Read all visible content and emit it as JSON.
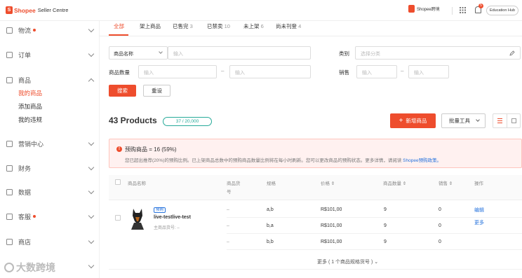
{
  "topbar": {
    "logo_text": "Shopee",
    "logo_sub": "Seller Centre",
    "store_label": "Shopee跨境",
    "notification_count": "5",
    "education_hub": "Education Hub"
  },
  "sidebar": {
    "items": [
      {
        "label": "物流",
        "dot": true
      },
      {
        "label": "订单",
        "dot": false
      },
      {
        "label": "商品",
        "dot": false
      },
      {
        "label": "营销中心",
        "dot": false
      },
      {
        "label": "财务",
        "dot": false
      },
      {
        "label": "数据",
        "dot": false
      },
      {
        "label": "客服",
        "dot": true
      },
      {
        "label": "商店",
        "dot": false
      }
    ],
    "sub_items": [
      "我的商品",
      "添加商品",
      "我的违规"
    ]
  },
  "tabs": [
    {
      "label": "全部",
      "count": ""
    },
    {
      "label": "架上商品",
      "count": ""
    },
    {
      "label": "已售完",
      "count": "3"
    },
    {
      "label": "已禁卖",
      "count": "10"
    },
    {
      "label": "未上架",
      "count": "6"
    },
    {
      "label": "尚未刊登",
      "count": "4"
    }
  ],
  "filters": {
    "name_select": "商品名称",
    "name_placeholder": "输入",
    "category_label": "类别",
    "category_placeholder": "选择分类",
    "qty_label": "商品数量",
    "qty_min_placeholder": "输入",
    "qty_max_placeholder": "输入",
    "sales_label": "销售",
    "sales_min_placeholder": "输入",
    "sales_max_placeholder": "输入",
    "range_sep": "–",
    "search_button": "搜索",
    "reset_button": "重设"
  },
  "products_header": {
    "title": "43 Products",
    "count_badge": "37 / 20,000",
    "add_button": "新增商品",
    "bulk_tools": "批量工具"
  },
  "alert": {
    "title": "预购商品 = 16 (59%)",
    "body": "您已超出推荐(20%)的预购比例。已上架商品总数中的预购商品数量比例将在每小时刷新。您可以更改商品的预购状态。更多详情，请阅读",
    "link": "Shopee预购政策。"
  },
  "table": {
    "headers": {
      "name": "商品名称",
      "sku": "商品货",
      "sku2": "号",
      "variation": "规格",
      "price": "价格",
      "stock": "商品数量",
      "sales": "销售",
      "action": "操作"
    },
    "product": {
      "tag": "预购",
      "name": "live-testlive-test",
      "parent_sku": "主商品货号: –"
    },
    "rows": [
      {
        "sku": "–",
        "variation": "a,b",
        "price": "R$101,00",
        "stock": "9",
        "sales": "0"
      },
      {
        "sku": "–",
        "variation": "b,a",
        "price": "R$101,00",
        "stock": "9",
        "sales": "0"
      },
      {
        "sku": "–",
        "variation": "b,b",
        "price": "R$101,00",
        "stock": "9",
        "sales": "0"
      }
    ],
    "actions": {
      "edit": "编辑",
      "more": "更多"
    },
    "more_variations": "更多 ( 1 个商品规格货号 )"
  },
  "watermark": "大数跨境",
  "colors": {
    "brand": "#ee4d2d",
    "link": "#2673dd",
    "teal": "#26aa99"
  }
}
